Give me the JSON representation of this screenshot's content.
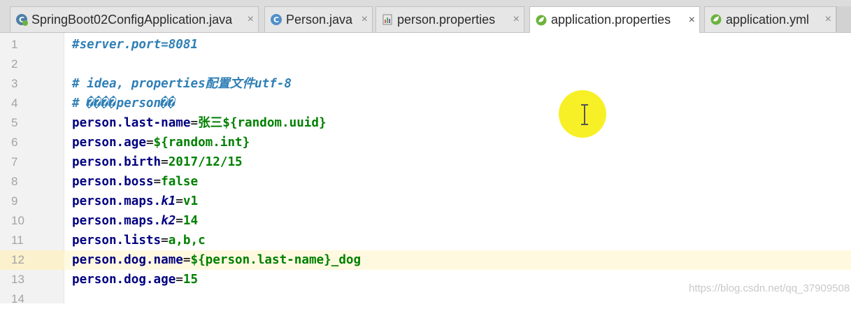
{
  "tabs": [
    {
      "label": "SpringBoot02ConfigApplication.java",
      "icon": "spring-java-class-icon",
      "close": "×",
      "active": false
    },
    {
      "label": "Person.java",
      "icon": "java-class-icon",
      "close": "×",
      "active": false
    },
    {
      "label": "person.properties",
      "icon": "properties-file-icon",
      "close": "×",
      "active": false
    },
    {
      "label": "application.properties",
      "icon": "spring-properties-icon",
      "close": "×",
      "active": true
    },
    {
      "label": "application.yml",
      "icon": "spring-yml-icon",
      "close": "×",
      "active": false
    }
  ],
  "editor": {
    "current_line": 12,
    "lines": [
      {
        "n": "1",
        "text": "#server.port=8081"
      },
      {
        "n": "2",
        "text": ""
      },
      {
        "n": "3",
        "text": "# idea, properties配置文件utf-8"
      },
      {
        "n": "4",
        "text": "# ����person��"
      },
      {
        "n": "5",
        "key": "person.last-name",
        "eq": "=",
        "value": "张三${random.uuid}"
      },
      {
        "n": "6",
        "key": "person.age",
        "eq": "=",
        "value": "${random.int}"
      },
      {
        "n": "7",
        "key": "person.birth",
        "eq": "=",
        "value": "2017/12/15"
      },
      {
        "n": "8",
        "key": "person.boss",
        "eq": "=",
        "value": "false"
      },
      {
        "n": "9",
        "key_a": "person.maps.",
        "key_b": "k1",
        "eq": "=",
        "value": "v1"
      },
      {
        "n": "10",
        "key_a": "person.maps.",
        "key_b": "k2",
        "eq": "=",
        "value": "14"
      },
      {
        "n": "11",
        "key": "person.lists",
        "eq": "=",
        "value": "a,b,c"
      },
      {
        "n": "12",
        "key": "person.dog.name",
        "eq": "=",
        "value": "${person.last-name}_dog"
      },
      {
        "n": "13",
        "key": "person.dog.age",
        "eq": "=",
        "value": "15"
      },
      {
        "n": "14",
        "text": ""
      }
    ]
  },
  "watermark": "https://blog.csdn.net/qq_37909508",
  "colors": {
    "key": "#000080",
    "value": "#008000",
    "comment": "#2f7fb6",
    "current_line": "#fff9e0",
    "cursor_highlight": "#f7ef1a"
  }
}
